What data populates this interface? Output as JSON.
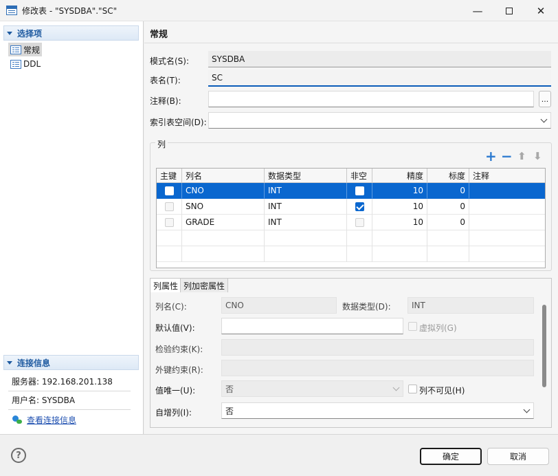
{
  "window": {
    "title": "修改表 - \"SYSDBA\".\"SC\"",
    "min_glyph": "—",
    "close_glyph": "✕"
  },
  "sidebar": {
    "options_header": "选择项",
    "items": [
      {
        "label": "常规",
        "icon": "table-icon",
        "selected": true
      },
      {
        "label": "DDL",
        "icon": "table-icon",
        "selected": false
      }
    ],
    "connection_header": "连接信息",
    "server": "服务器: 192.168.201.138",
    "user": "用户名: SYSDBA",
    "view_link": "查看连接信息"
  },
  "form": {
    "section_title": "常规",
    "schema_label": "模式名(S):",
    "schema_value": "SYSDBA",
    "table_label": "表名(T):",
    "table_value": "SC",
    "comment_label": "注释(B):",
    "comment_value": "",
    "more_button": "...",
    "tablespace_label": "索引表空间(D):",
    "tablespace_value": ""
  },
  "columns": {
    "group_label": "列",
    "toolbar": {
      "add": "+",
      "remove": "−",
      "up": "⬆",
      "down": "⬇"
    },
    "headers": [
      "主键",
      "列名",
      "数据类型",
      "非空",
      "精度",
      "标度",
      "注释"
    ],
    "rows": [
      {
        "pk": false,
        "name": "CNO",
        "type": "INT",
        "not_null": false,
        "precision": "10",
        "scale": "0",
        "comment": "",
        "selected": true
      },
      {
        "pk": false,
        "name": "SNO",
        "type": "INT",
        "not_null": true,
        "precision": "10",
        "scale": "0",
        "comment": "",
        "selected": false
      },
      {
        "pk": false,
        "name": "GRADE",
        "type": "INT",
        "not_null": false,
        "precision": "10",
        "scale": "0",
        "comment": "",
        "selected": false
      }
    ]
  },
  "props": {
    "tabs": [
      "列属性",
      "列加密属性"
    ],
    "active_tab": 0,
    "col_name_label": "列名(C):",
    "col_name_value": "CNO",
    "data_type_label": "数据类型(D):",
    "data_type_value": "INT",
    "default_label": "默认值(V):",
    "default_value": "",
    "virtual_label": "虚拟列(G)",
    "check_label": "检验约束(K):",
    "fk_label": "外键约束(R):",
    "unique_label": "值唯一(U):",
    "unique_value": "否",
    "invisible_label": "列不可见(H)",
    "identity_label": "自增列(I):",
    "identity_value": "否"
  },
  "footer": {
    "help": "?",
    "ok": "确定",
    "cancel": "取消"
  },
  "colors": {
    "accent": "#0a67cf",
    "link": "#1e4fb0",
    "section_header": "#1e5aa0"
  }
}
